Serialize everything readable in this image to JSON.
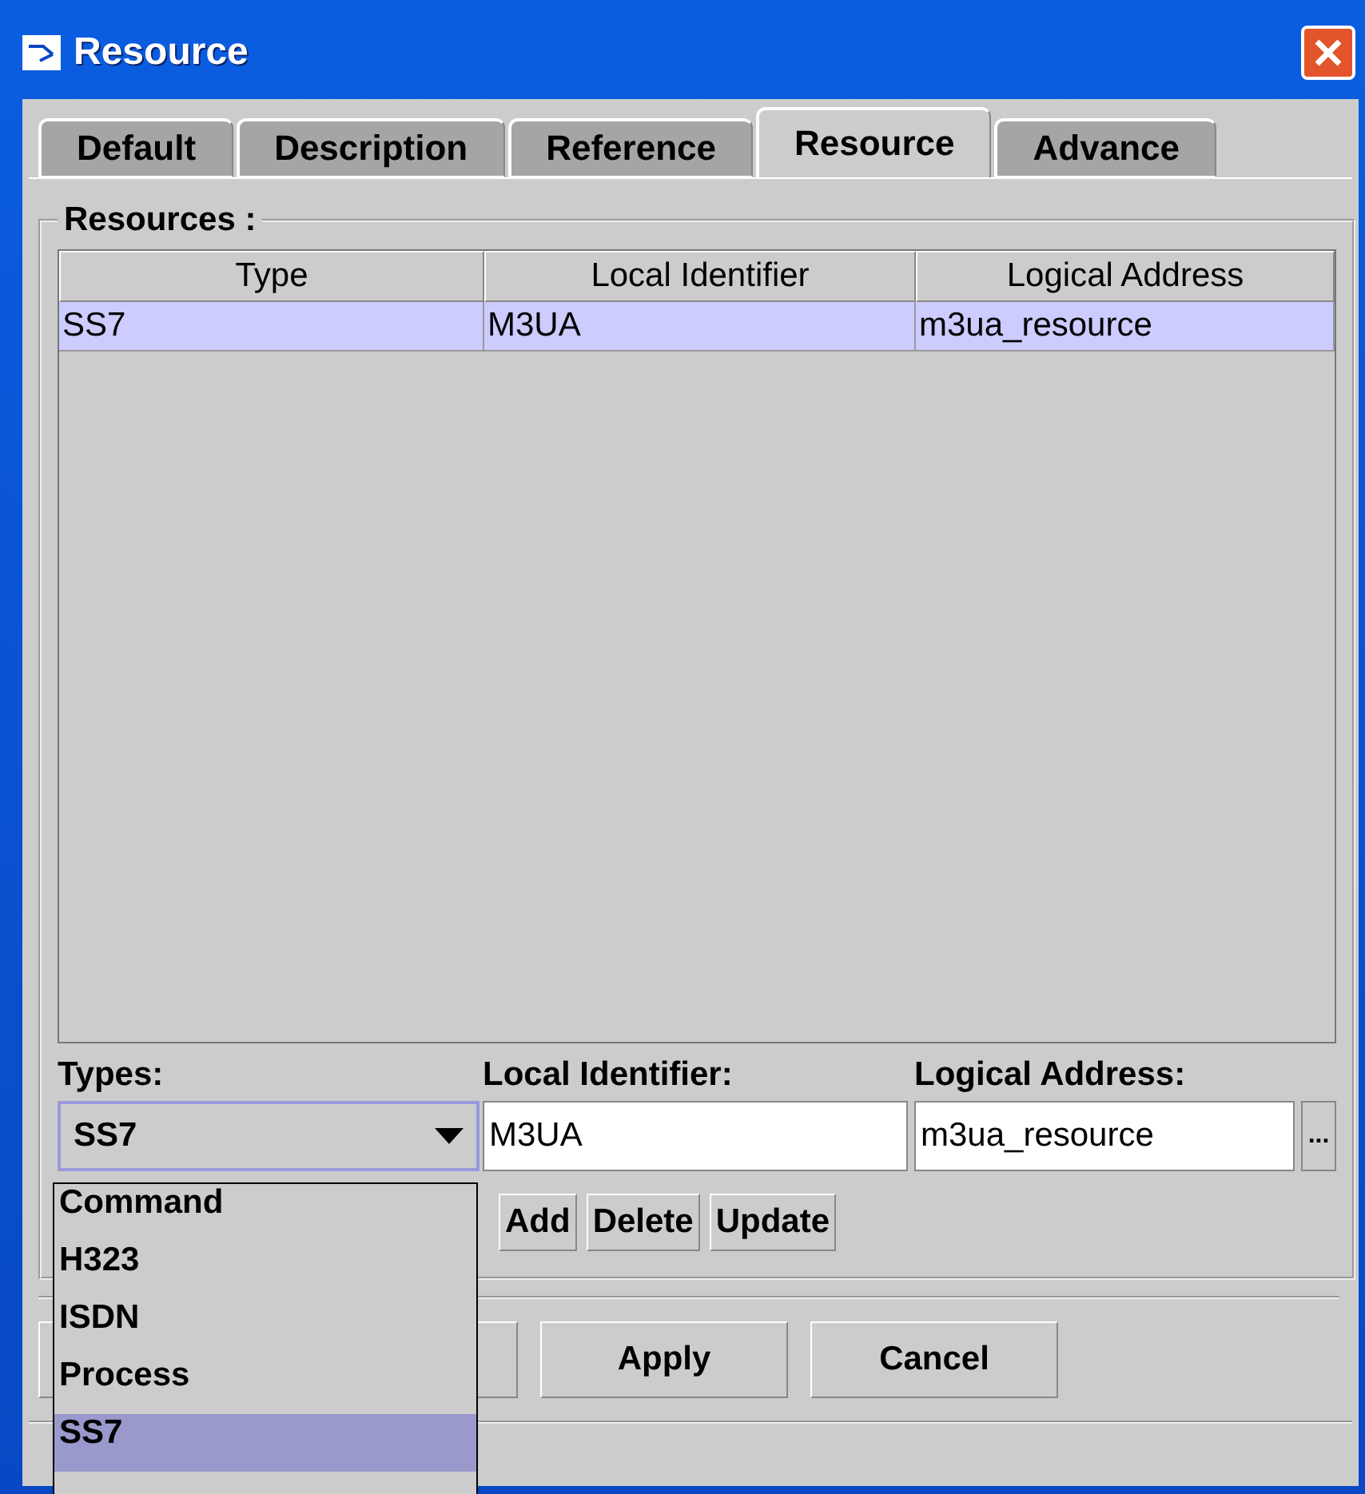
{
  "window": {
    "title": "Resource"
  },
  "tabs": [
    {
      "label": "Default",
      "selected": false
    },
    {
      "label": "Description",
      "selected": false
    },
    {
      "label": "Reference",
      "selected": false
    },
    {
      "label": "Resource",
      "selected": true
    },
    {
      "label": "Advance",
      "selected": false
    }
  ],
  "group": {
    "title": "Resources :"
  },
  "table": {
    "columns": [
      "Type",
      "Local Identifier",
      "Logical Address"
    ],
    "rows": [
      {
        "cells": [
          "SS7",
          "M3UA",
          "m3ua_resource"
        ],
        "selected": true
      }
    ]
  },
  "form": {
    "fields": [
      {
        "label": "Types:",
        "kind": "combo",
        "value": "SS7"
      },
      {
        "label": "Local Identifier:",
        "kind": "text",
        "value": "M3UA"
      },
      {
        "label": "Logical Address:",
        "kind": "browse",
        "value": "m3ua_resource",
        "button": "..."
      }
    ]
  },
  "row_buttons": [
    "Add",
    "Delete",
    "Update"
  ],
  "dialog_buttons": [
    "Apply",
    "Cancel"
  ],
  "dropdown": {
    "items": [
      {
        "label": "Command",
        "selected": false
      },
      {
        "label": "H323",
        "selected": false
      },
      {
        "label": "ISDN",
        "selected": false
      },
      {
        "label": "Process",
        "selected": false
      },
      {
        "label": "SS7",
        "selected": true
      }
    ]
  }
}
